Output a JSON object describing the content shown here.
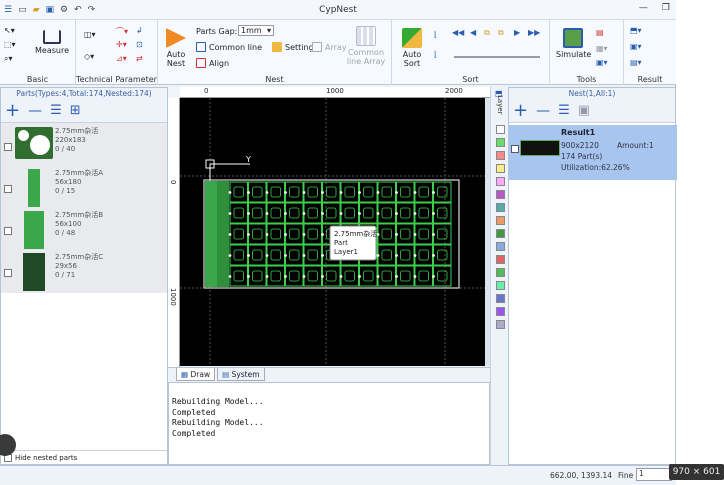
{
  "window": {
    "title": "CypNest"
  },
  "ribbon": {
    "parts_gap_label": "Parts Gap:",
    "parts_gap_value": "1mm",
    "common_line": "Common line",
    "setting": "Setting",
    "align": "Align",
    "array": "Array",
    "common_line_array": "Common line Array",
    "measure": "Measure",
    "auto_nest": "Auto Nest",
    "auto_sort": "Auto Sort",
    "simulate": "Simulate",
    "groups": {
      "basic": "Basic",
      "technical_parameter": "Technical Parameter",
      "nest": "Nest",
      "sort": "Sort",
      "tools": "Tools",
      "result": "Result"
    }
  },
  "parts_panel": {
    "header": "Parts(Types:4,Total:174,Nested:174)",
    "items": [
      {
        "name": "2.75mm杂活",
        "size": "220x183",
        "count": "0 / 40"
      },
      {
        "name": "2.75mm杂活A",
        "size": "56x180",
        "count": "0 / 15"
      },
      {
        "name": "2.75mm杂活B",
        "size": "56x100",
        "count": "0 / 48"
      },
      {
        "name": "2.75mm杂活C",
        "size": "29x56",
        "count": "0 / 71"
      }
    ],
    "hide_nested": "Hide nested parts"
  },
  "canvas": {
    "ruler_top_labels": [
      "0",
      "1000",
      "2000"
    ],
    "ruler_left_labels": [
      "0",
      "1000"
    ],
    "axis_y_label": "Y",
    "tooltip": [
      "2.75mm杂活",
      "Part",
      "Layer1"
    ]
  },
  "tabs": [
    "Draw",
    "System"
  ],
  "console": "Rebuilding Model...\nCompleted\nRebuilding Model...\nCompleted",
  "layer_panel": {
    "label": "Layer",
    "colors": [
      "#ffffff",
      "#66dd66",
      "#ff8888",
      "#ffee88",
      "#ffaaff",
      "#bb55cc",
      "#55aaaa",
      "#ee9966",
      "#449944",
      "#88aadd",
      "#dd6666",
      "#55bb55",
      "#66eeaa",
      "#6677cc",
      "#9955ee",
      "#aaaacc"
    ]
  },
  "nest_panel": {
    "header": "Nest(1,All:1)",
    "result_title": "Result1",
    "sheet_size": "900x2120",
    "parts": "174 Part(s)",
    "utilization": "Utilization:62.26%",
    "amount": "Amount:1"
  },
  "status": {
    "coords": "662.00, 1393.14",
    "fine_label": "Fine",
    "fine_value": "1"
  },
  "overlay": {
    "dimensions": "970 × 601"
  }
}
